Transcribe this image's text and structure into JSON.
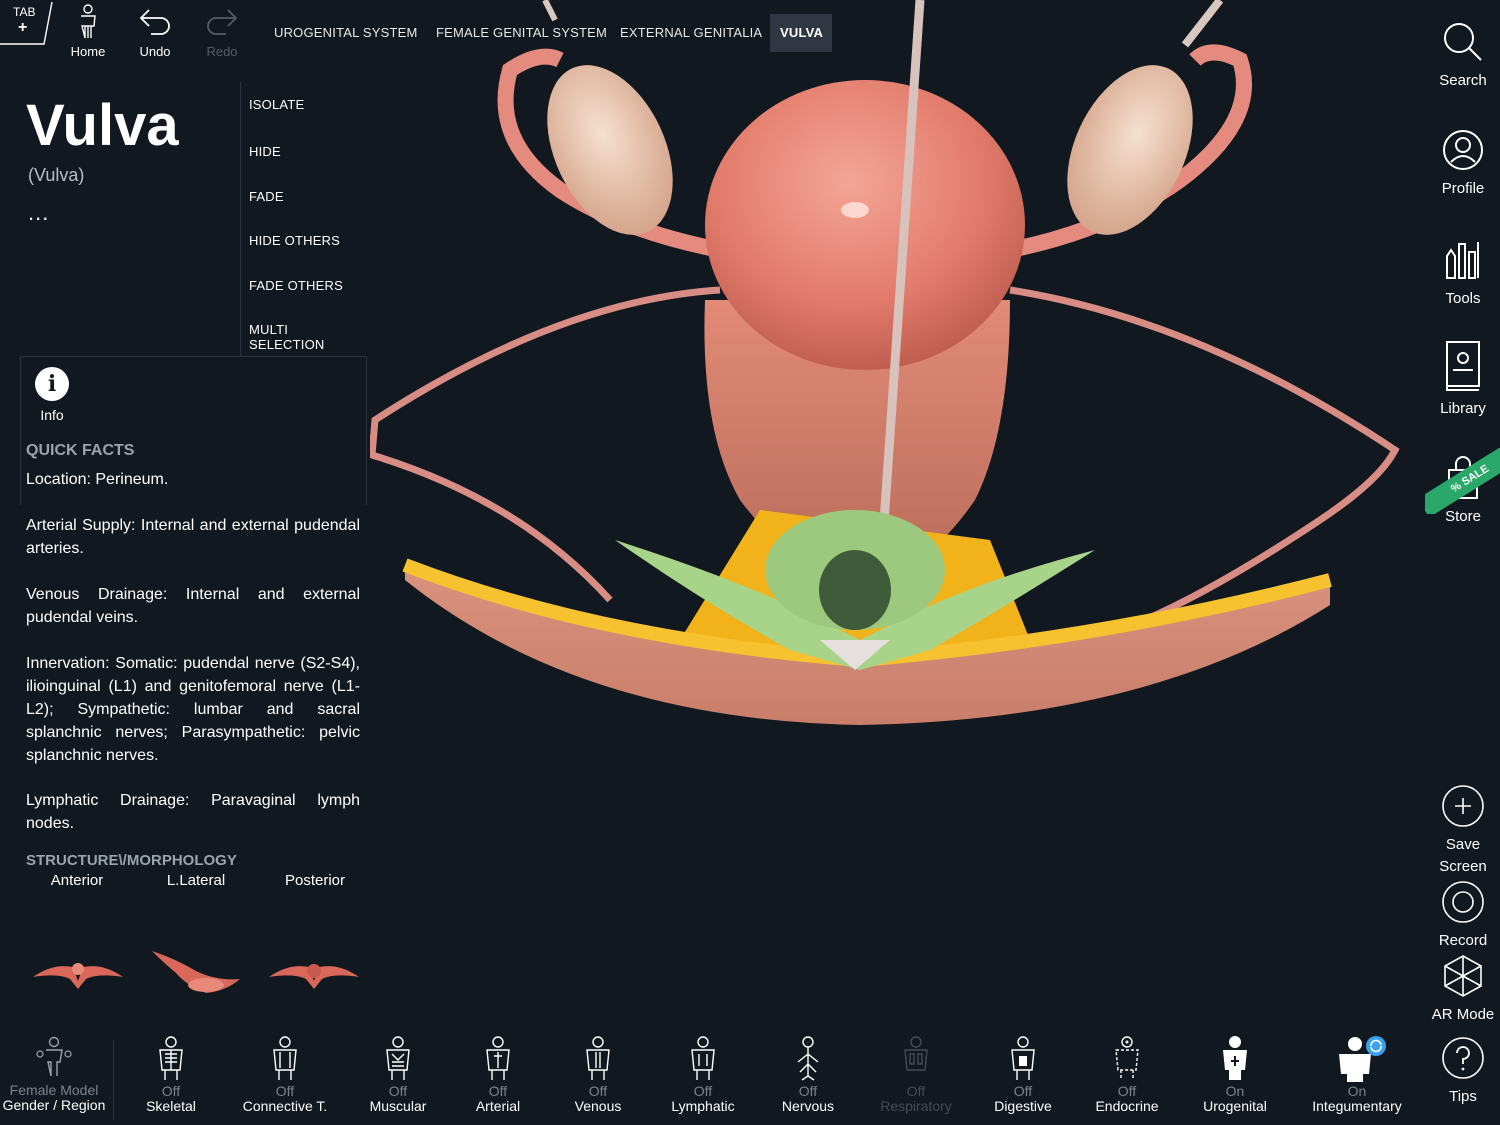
{
  "toolbar": {
    "tab_label": "TAB",
    "tab_plus": "+",
    "home_label": "Home",
    "undo_label": "Undo",
    "redo_label": "Redo"
  },
  "breadcrumbs": [
    "UROGENITAL SYSTEM",
    "FEMALE GENITAL SYSTEM",
    "EXTERNAL GENITALIA",
    "VULVA"
  ],
  "structure": {
    "title": "Vulva",
    "latin": "(Vulva)",
    "more": "..."
  },
  "actions": [
    "ISOLATE",
    "HIDE",
    "FADE",
    "HIDE OTHERS",
    "FADE OTHERS",
    "MULTI SELECTION"
  ],
  "info": {
    "icon_glyph": "i",
    "label": "Info"
  },
  "quick_facts": {
    "header": "QUICK FACTS",
    "location": "Location: Perineum.",
    "arterial": "Arterial Supply: Internal and external pudendal arteries.",
    "venous": "Venous Drainage: Internal and external pudendal veins.",
    "innervation": "Innervation: Somatic: pudendal nerve (S2-S4), ilioinguinal (L1) and genitofemoral nerve (L1-L2); Sympathetic: lumbar and sacral splanchnic nerves; Parasympathetic: pelvic splanchnic nerves.",
    "lymphatic": "Lymphatic Drainage: Paravaginal lymph nodes."
  },
  "structure_header": "STRUCTURE\\/MORPHOLOGY",
  "views": [
    "Anterior",
    "L.Lateral",
    "Posterior"
  ],
  "sidebar": {
    "search": "Search",
    "profile": "Profile",
    "tools": "Tools",
    "library": "Library",
    "store": "Store",
    "sale_badge": "% SALE",
    "save_screen_1": "Save",
    "save_screen_2": "Screen",
    "record": "Record",
    "ar_mode": "AR Mode",
    "tips": "Tips"
  },
  "model": {
    "name": "Female Model",
    "sub": "Gender / Region"
  },
  "systems": [
    {
      "state": "Off",
      "name": "Skeletal"
    },
    {
      "state": "Off",
      "name": "Connective T."
    },
    {
      "state": "Off",
      "name": "Muscular"
    },
    {
      "state": "Off",
      "name": "Arterial"
    },
    {
      "state": "Off",
      "name": "Venous"
    },
    {
      "state": "Off",
      "name": "Lymphatic"
    },
    {
      "state": "Off",
      "name": "Nervous"
    },
    {
      "state": "Off",
      "name": "Respiratory"
    },
    {
      "state": "Off",
      "name": "Digestive"
    },
    {
      "state": "Off",
      "name": "Endocrine"
    },
    {
      "state": "On",
      "name": "Urogenital"
    },
    {
      "state": "On",
      "name": "Integumentary"
    }
  ],
  "colors": {
    "background": "#121820",
    "active_crumb": "#303742",
    "sale_green": "#2aa86a",
    "sync_blue": "#3aa0f0",
    "tissue_pink": "#e8907a",
    "fat_yellow": "#f2b21a",
    "mucosa_green": "#a8d48a"
  }
}
